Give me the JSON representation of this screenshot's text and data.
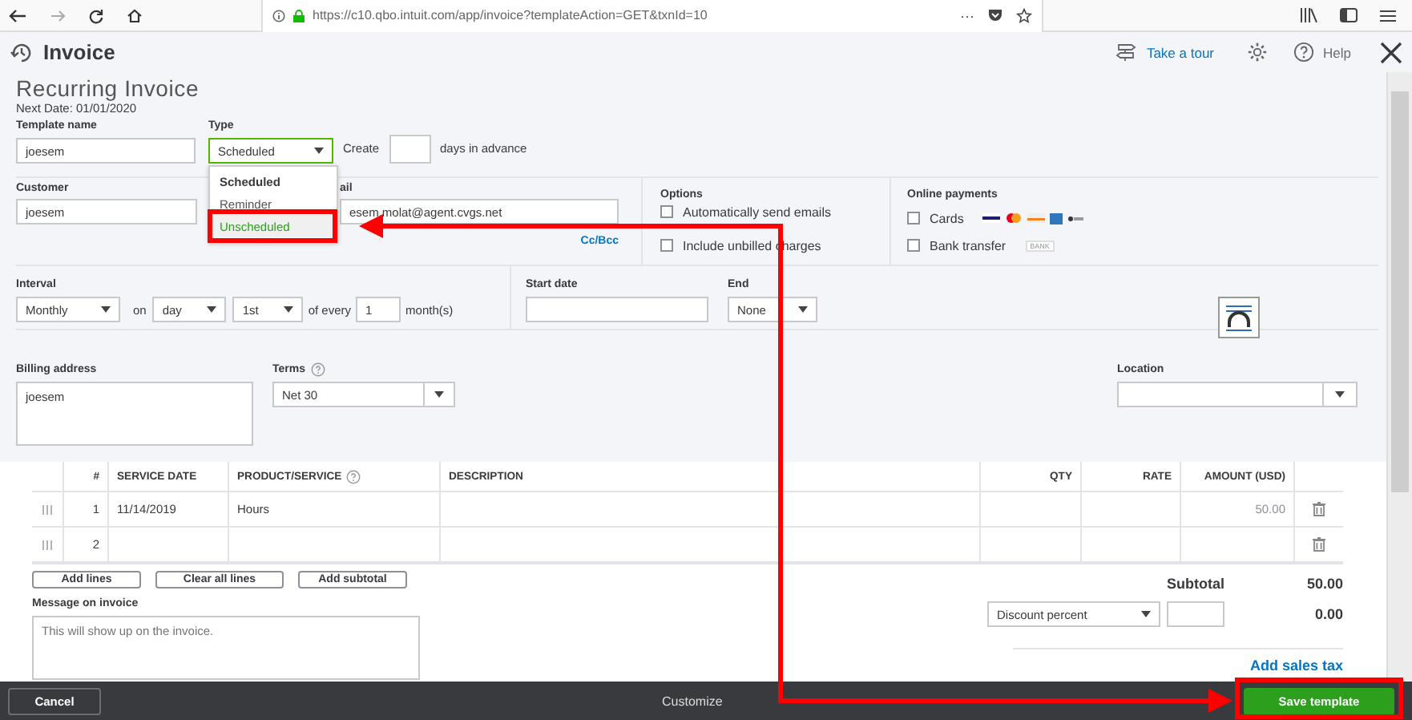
{
  "browser": {
    "url": "https://c10.qbo.intuit.com/app/invoice?templateAction=GET&txnId=10",
    "more": "···"
  },
  "header": {
    "title": "Invoice",
    "tour": "Take a tour",
    "help": "Help"
  },
  "form": {
    "heading": "Recurring Invoice",
    "next_date": "Next Date: 01/01/2020",
    "template_name": {
      "label": "Template name",
      "value": "joesem"
    },
    "type": {
      "label": "Type",
      "value": "Scheduled",
      "expanded": true,
      "options": [
        {
          "label": "Scheduled",
          "selected": true,
          "hovered": false
        },
        {
          "label": "Reminder",
          "selected": false,
          "hovered": false
        },
        {
          "label": "Unscheduled",
          "selected": false,
          "hovered": true
        }
      ]
    },
    "create": {
      "label": "Create",
      "suffix": "days in advance"
    },
    "customer": {
      "label": "Customer",
      "value": "joesem"
    },
    "email": {
      "label": "ail",
      "value": "esem.molat@agent.cvgs.net",
      "cc": "Cc/Bcc"
    },
    "options": {
      "label": "Options",
      "items": [
        {
          "label": "Automatically send emails",
          "checked": false
        },
        {
          "label": "Include unbilled charges",
          "checked": false
        }
      ]
    },
    "online_payments": {
      "label": "Online payments",
      "items": [
        {
          "kind": "cards",
          "label": "Cards",
          "checked": false
        },
        {
          "kind": "bank",
          "label": "Bank transfer",
          "checked": false,
          "badge": "BANK"
        }
      ]
    },
    "interval": {
      "label": "Interval",
      "frequency": "Monthly",
      "on": "on",
      "day": "day",
      "ordinal": "1st",
      "of_every": "of every",
      "count": "1",
      "unit": "month(s)"
    },
    "start_date": {
      "label": "Start date"
    },
    "end": {
      "label": "End",
      "value": "None"
    },
    "billing_address": {
      "label": "Billing address",
      "value": "joesem"
    },
    "terms": {
      "label": "Terms",
      "value": "Net 30"
    },
    "location": {
      "label": "Location"
    }
  },
  "table": {
    "columns": [
      "#",
      "SERVICE DATE",
      "PRODUCT/SERVICE",
      "DESCRIPTION",
      "QTY",
      "RATE",
      "AMOUNT (USD)"
    ],
    "rows": [
      {
        "num": "1",
        "service_date": "11/14/2019",
        "product": "Hours",
        "amount": "50.00"
      },
      {
        "num": "2"
      }
    ]
  },
  "line_buttons": [
    "Add lines",
    "Clear all lines",
    "Add subtotal"
  ],
  "message": {
    "label": "Message on invoice",
    "placeholder": "This will show up on the invoice."
  },
  "totals": {
    "subtotal_label": "Subtotal",
    "subtotal": "50.00",
    "discount": "Discount percent",
    "discount_amount": "0.00",
    "sales_tax": "Add sales tax"
  },
  "footer": {
    "cancel": "Cancel",
    "customize": "Customize",
    "save": "Save template"
  }
}
